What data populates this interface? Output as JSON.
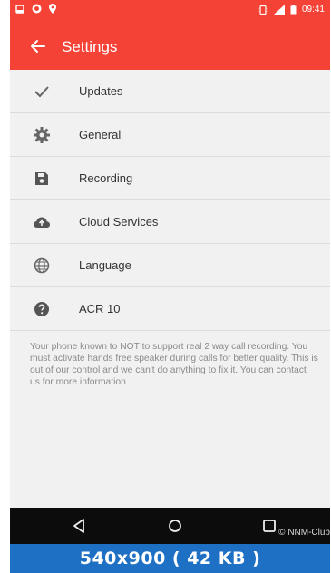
{
  "status_bar": {
    "time": "09:41",
    "icons_left": [
      "notification-icon",
      "whatsapp-icon",
      "location-pin-icon"
    ],
    "icons_right": [
      "vibrate-icon",
      "signal-icon",
      "battery-icon"
    ]
  },
  "app_bar": {
    "title": "Settings",
    "background": "#f44336"
  },
  "menu": {
    "items": [
      {
        "label": "Updates",
        "icon": "check-icon"
      },
      {
        "label": "General",
        "icon": "gear-icon"
      },
      {
        "label": "Recording",
        "icon": "save-icon"
      },
      {
        "label": "Cloud Services",
        "icon": "cloud-upload-icon"
      },
      {
        "label": "Language",
        "icon": "globe-icon"
      },
      {
        "label": "ACR 10",
        "icon": "help-icon"
      }
    ]
  },
  "note": "Your phone known to NOT to support real 2 way call recording. You must activate hands free speaker during calls for better quality. This is out of our control and we can't do anything to fix it. You can contact us for more information",
  "nav_bar": {
    "buttons": [
      "back-triangle-icon",
      "home-circle-icon",
      "recents-square-icon"
    ],
    "watermark": "© NNM-Club"
  },
  "caption": "540x900 ( 42 KB )"
}
